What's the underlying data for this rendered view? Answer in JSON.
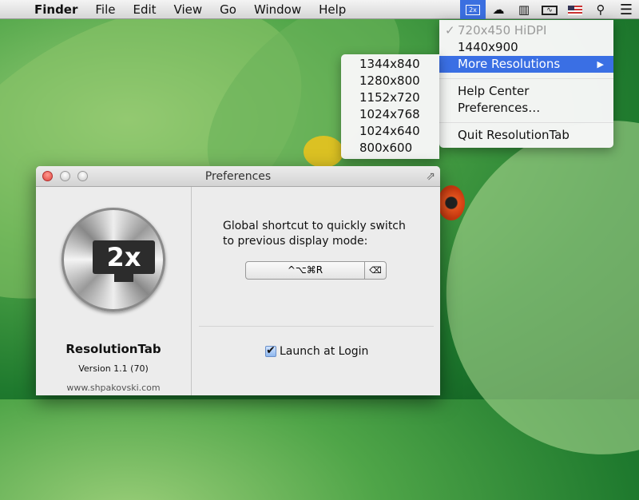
{
  "menubar": {
    "apple": "",
    "app": "Finder",
    "items": [
      "File",
      "Edit",
      "View",
      "Go",
      "Window",
      "Help"
    ]
  },
  "status_icons": [
    "resolutiontab-2x-icon",
    "cloud-icon",
    "battery-bars-icon",
    "activity-monitor-icon",
    "us-flag-icon",
    "search-icon",
    "list-icon"
  ],
  "menu": {
    "items": [
      {
        "label": "720x450 HiDPI",
        "checked": true,
        "disabled": true
      },
      {
        "label": "1440x900"
      },
      {
        "label": "More Resolutions",
        "submenu": true,
        "highlighted": true
      },
      {
        "label": "Help Center"
      },
      {
        "label": "Preferences…"
      },
      {
        "label": "Quit ResolutionTab"
      }
    ]
  },
  "submenu": {
    "items": [
      "1344x840",
      "1280x800",
      "1152x720",
      "1024x768",
      "1024x640",
      "800x600"
    ]
  },
  "window": {
    "title": "Preferences",
    "app_name": "ResolutionTab",
    "version": "Version 1.1 (70)",
    "website": "www.shpakovski.com",
    "icon_text": "2x",
    "shortcut_label": "Global shortcut to quickly switch to previous display mode:",
    "shortcut_value": "^⌥⌘R",
    "clear_glyph": "⌫",
    "launch_label": "Launch at Login",
    "launch_checked": true
  },
  "colors": {
    "highlight": "#3a6fe4",
    "close": "#e0443e"
  }
}
